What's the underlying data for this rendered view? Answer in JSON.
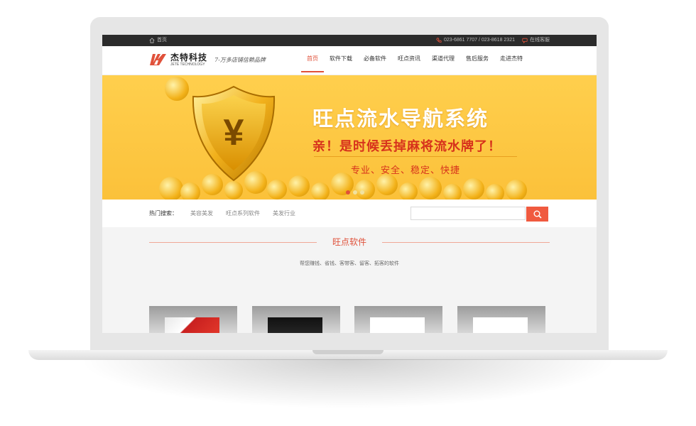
{
  "topbar": {
    "home_label": "首页",
    "phone_label": "023-6861 7707 / 023-8618 2321",
    "chat_label": "在线客服"
  },
  "header": {
    "logo_cn": "杰特科技",
    "logo_en": "JETE TECHNOLOGY",
    "slogan": "7-万多店铺信赖品牌"
  },
  "nav": {
    "items": [
      {
        "label": "首页"
      },
      {
        "label": "软件下载"
      },
      {
        "label": "必备软件"
      },
      {
        "label": "旺点资讯"
      },
      {
        "label": "渠道代理"
      },
      {
        "label": "售后服务"
      },
      {
        "label": "走进杰特"
      }
    ]
  },
  "banner": {
    "title": "旺点流水导航系统",
    "subtitle": "亲！是时候丢掉麻将流水牌了！",
    "tagline": "专业、安全、稳定、快捷",
    "currency_symbol": "¥"
  },
  "search": {
    "hot_label": "热门搜索：",
    "hot_links": [
      "美容美发",
      "旺点系列软件",
      "美发行业"
    ],
    "placeholder": ""
  },
  "section": {
    "title": "旺点软件",
    "subtitle": "帮您赚钱、省钱、客带客、留客、拓客的软件"
  },
  "colors": {
    "accent": "#e0513a",
    "banner_yellow": "#ffcf4d",
    "topbar": "#2b2b2b"
  }
}
